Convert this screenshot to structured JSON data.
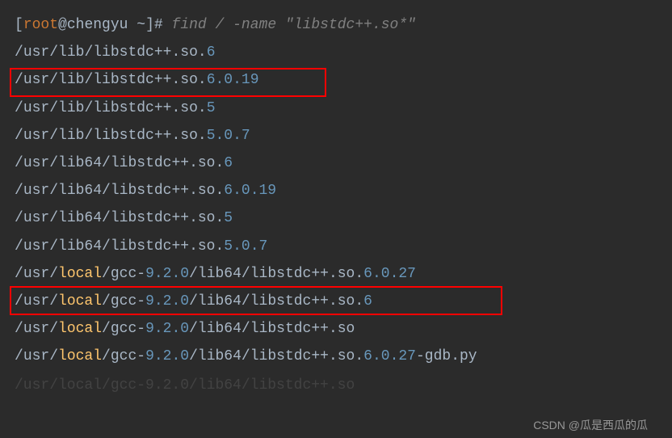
{
  "prompt": {
    "open_bracket": "[",
    "user": "root",
    "at": "@",
    "host": "chengyu",
    "space": " ",
    "dir": "~",
    "close_bracket": "]",
    "hash": "# "
  },
  "command": {
    "text": "find / -name \"libstdc++.so*\""
  },
  "lines": {
    "l1": "/usr/lib/libstdc++.so.6",
    "l2": "/usr/lib/libstdc++.so.6.0.19",
    "l3": "/usr/lib/libstdc++.so.5",
    "l4": "/usr/lib/libstdc++.so.5.0.7",
    "l5": "/usr/lib64/libstdc++.so.6",
    "l6": "/usr/lib64/libstdc++.so.6.0.19",
    "l7": "/usr/lib64/libstdc++.so.5",
    "l8": "/usr/lib64/libstdc++.so.5.0.7",
    "l9": "/usr/local/gcc-9.2.0/lib64/libstdc++.so.6.0.27",
    "l10": "/usr/local/gcc-9.2.0/lib64/libstdc++.so.6",
    "l11": "/usr/local/gcc-9.2.0/lib64/libstdc++.so",
    "l12": "/usr/local/gcc-9.2.0/lib64/libstdc++.so.6.0.27-gdb.py",
    "faded": "/usr/local/gcc-9.2.0/lib64/libstdc++.so"
  },
  "watermark": "CSDN @瓜是西瓜的瓜",
  "colors": {
    "bg": "#2b2b2b",
    "text": "#a9b7c6",
    "number": "#6897bb",
    "orange": "#cc7832",
    "local": "#ffc66d",
    "highlight": "#ff0000",
    "comment": "#808080"
  }
}
